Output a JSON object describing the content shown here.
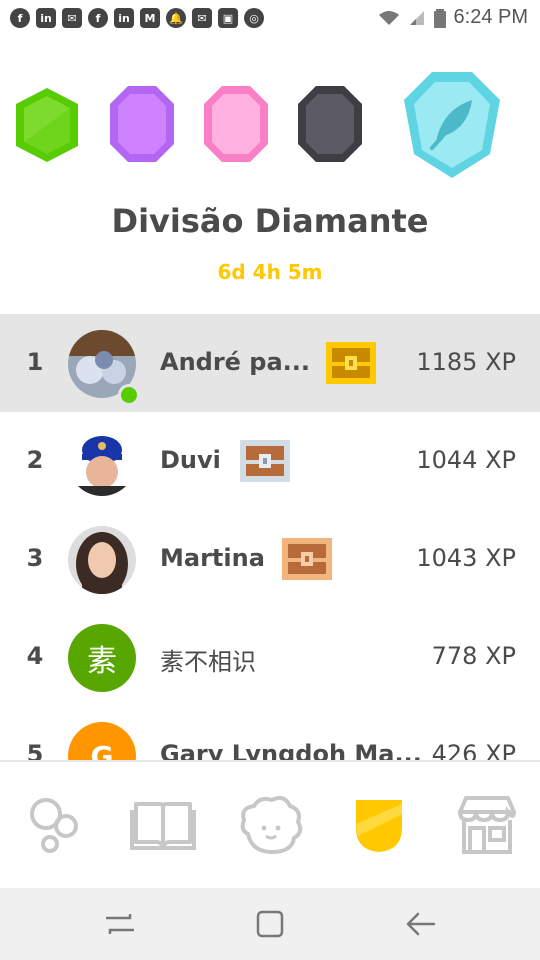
{
  "status_bar": {
    "time": "6:24 PM",
    "notification_icons": [
      "facebook-icon",
      "linkedin-icon",
      "mail-icon",
      "facebook-icon",
      "linkedin-icon",
      "gmail-icon",
      "bell-icon",
      "mail-icon",
      "image-icon",
      "chrome-icon"
    ]
  },
  "league": {
    "title": "Divisão Diamante",
    "countdown": "6d 4h 5m",
    "gems": [
      {
        "name": "green-league-gem",
        "color": "#58cc02"
      },
      {
        "name": "purple-league-gem",
        "color": "#ce82ff"
      },
      {
        "name": "pink-league-gem",
        "color": "#ff9ad8"
      },
      {
        "name": "obsidian-league-gem",
        "color": "#5a5863"
      },
      {
        "name": "diamond-league-gem",
        "color": "#8ee3ee"
      }
    ]
  },
  "leaderboard": {
    "rows": [
      {
        "rank": "1",
        "name": "André pa...",
        "xp": "1185 XP",
        "avatar": "photo",
        "chest": "gold"
      },
      {
        "rank": "2",
        "name": "Duvi",
        "xp": "1044 XP",
        "avatar": "photo",
        "chest": "silver"
      },
      {
        "rank": "3",
        "name": "Martina",
        "xp": "1043 XP",
        "avatar": "photo",
        "chest": "bronze"
      },
      {
        "rank": "4",
        "name": "素不相识",
        "xp": "778 XP",
        "avatar_letter": "素",
        "avatar_color": "#58a700"
      },
      {
        "rank": "5",
        "name": "Gary Lyngdoh Ma...",
        "xp": "426 XP",
        "avatar_letter": "G",
        "avatar_color": "#ff9600"
      }
    ]
  },
  "bottom_nav": {
    "items": [
      "learn-icon",
      "stories-icon",
      "profile-icon",
      "leaderboard-icon",
      "shop-icon"
    ],
    "active": "leaderboard-icon"
  },
  "colors": {
    "accent_yellow": "#ffc800",
    "highlight_row": "#e5e5e5",
    "text": "#4b4b4b"
  }
}
